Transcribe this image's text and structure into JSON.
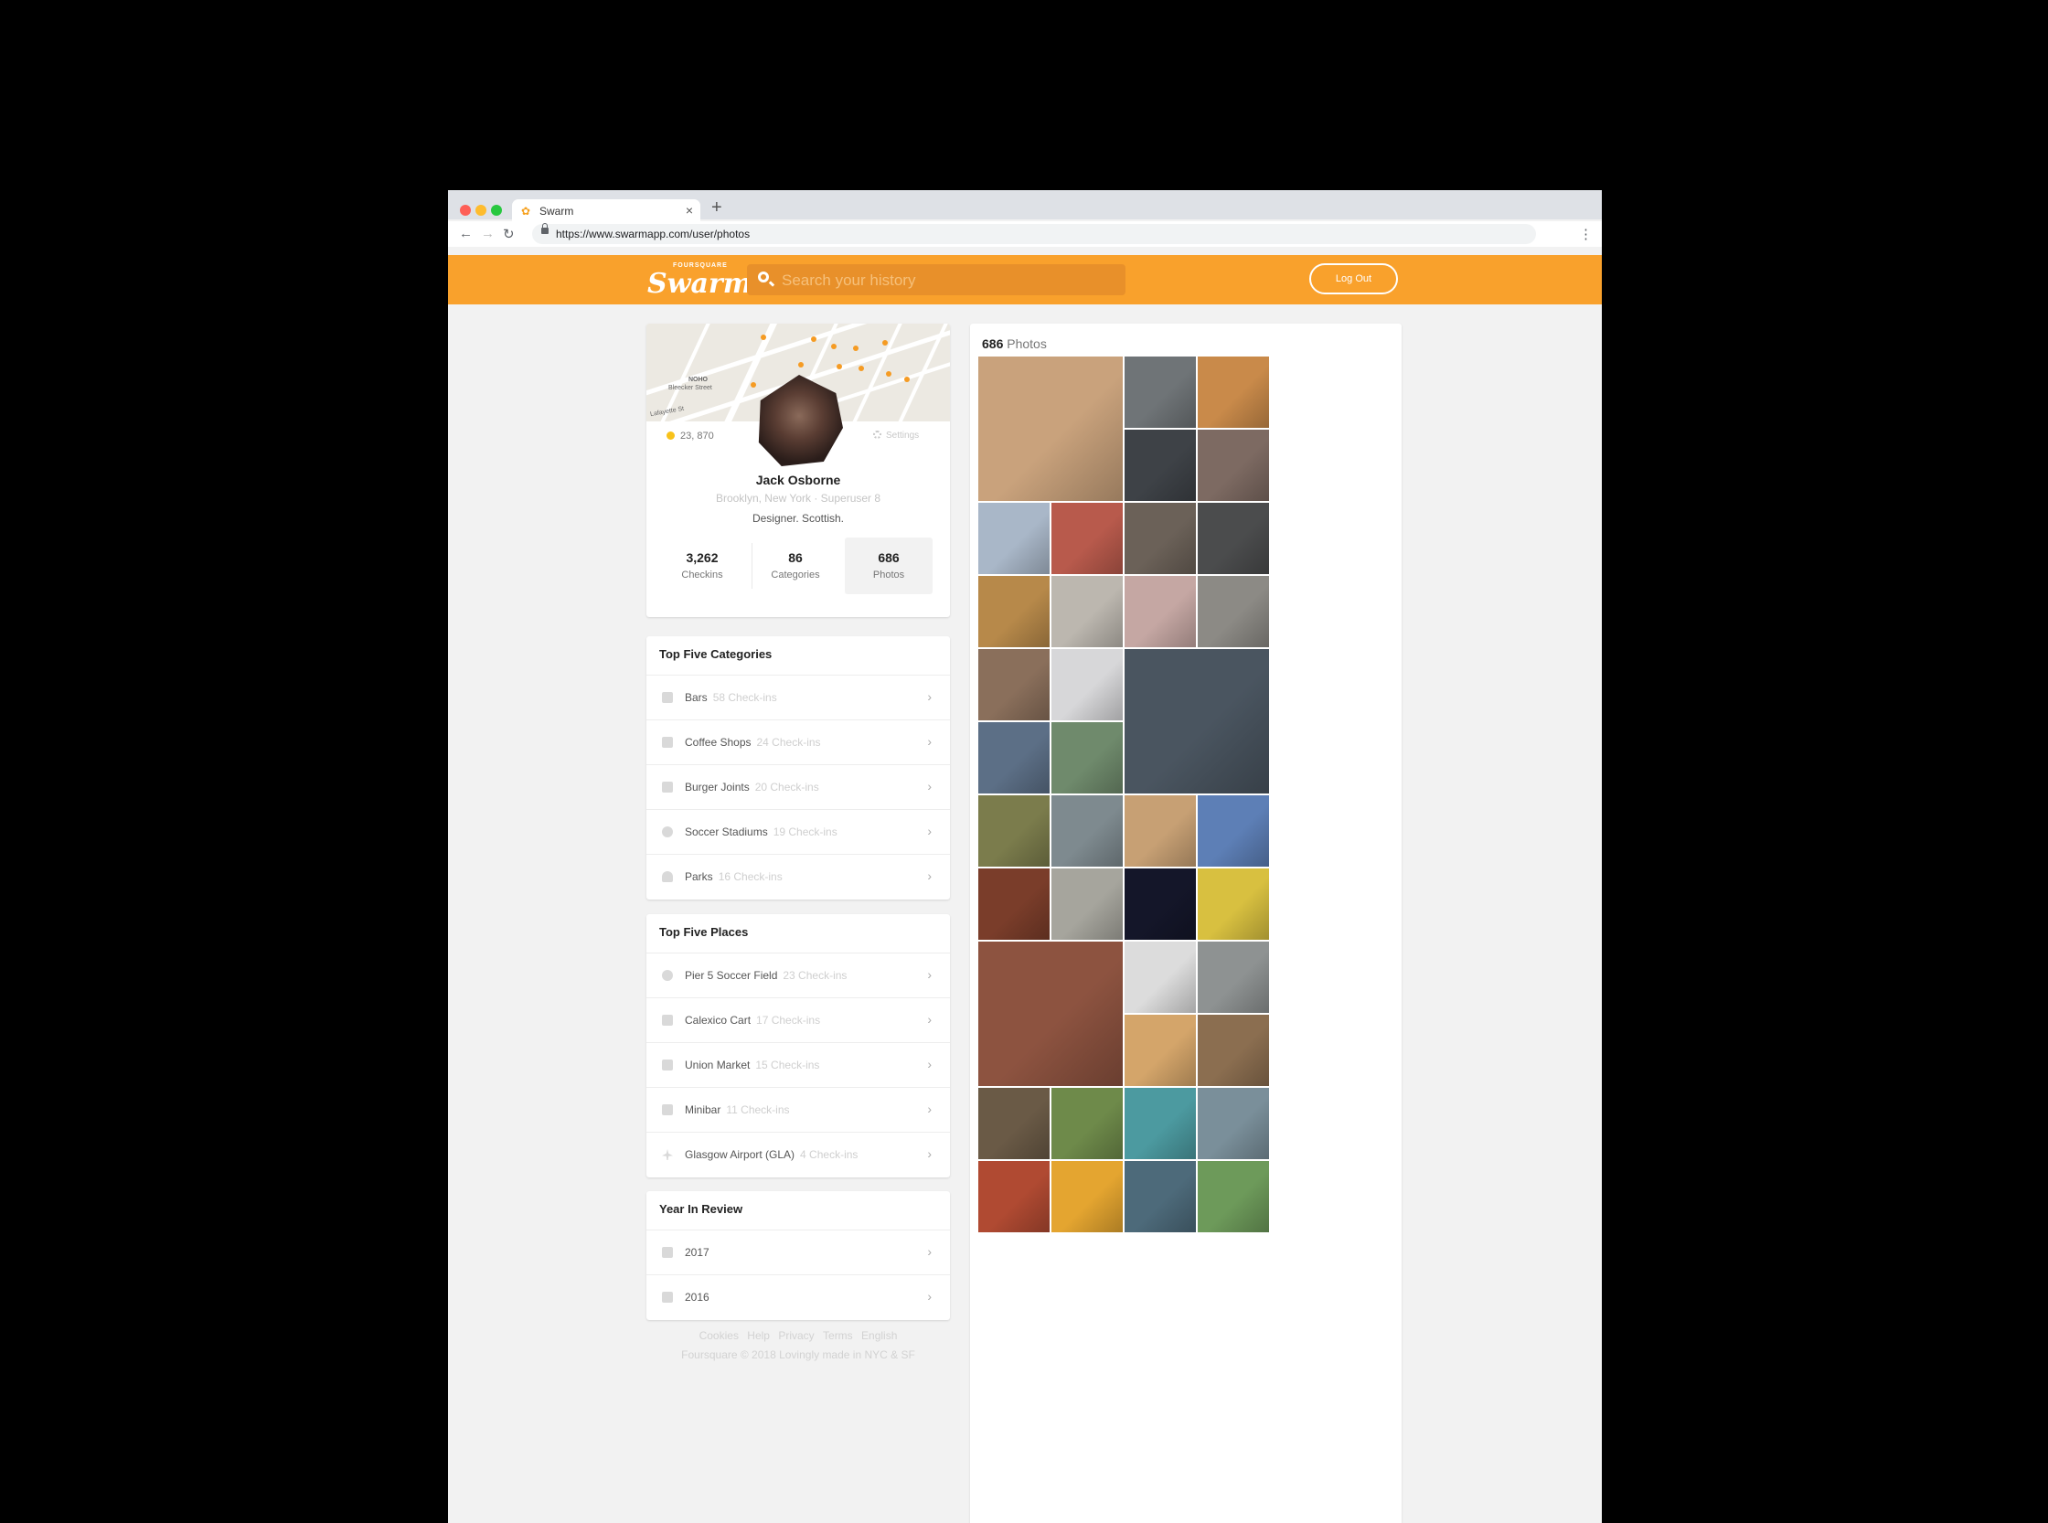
{
  "browser": {
    "tab_title": "Swarm",
    "tab_close": "×",
    "new_tab": "+",
    "url": "https://www.swarmapp.com/user/photos",
    "back": "←",
    "forward": "→",
    "reload": "↻",
    "menu": "⋮"
  },
  "header": {
    "logo_small": "FOURSQUARE",
    "logo_big": "Swarm",
    "search_placeholder": "Search your history",
    "logout_label": "Log Out",
    "brand_color": "#f9a12c"
  },
  "map": {
    "labels": [
      "NOHO",
      "Bleecker Street",
      "Lafayette St"
    ]
  },
  "profile": {
    "coins": "23, 870",
    "settings_label": "Settings",
    "name": "Jack Osborne",
    "location": "Brooklyn, New York · Superuser 8",
    "bio": "Designer. Scottish.",
    "stats": [
      {
        "value": "3,262",
        "label": "Checkins"
      },
      {
        "value": "86",
        "label": "Categories"
      },
      {
        "value": "686",
        "label": "Photos"
      }
    ]
  },
  "top_categories": {
    "title": "Top Five Categories",
    "items": [
      {
        "icon": "bar-icon",
        "name": "Bars",
        "count": "58 Check-ins"
      },
      {
        "icon": "coffee-icon",
        "name": "Coffee Shops",
        "count": "24 Check-ins"
      },
      {
        "icon": "burger-icon",
        "name": "Burger Joints",
        "count": "20 Check-ins"
      },
      {
        "icon": "soccer-ball-icon",
        "name": "Soccer Stadiums",
        "count": "19 Check-ins"
      },
      {
        "icon": "tree-icon",
        "name": "Parks",
        "count": "16 Check-ins"
      }
    ]
  },
  "top_places": {
    "title": "Top Five Places",
    "items": [
      {
        "icon": "soccer-ball-icon",
        "name": "Pier 5 Soccer Field",
        "count": "23 Check-ins"
      },
      {
        "icon": "food-truck-icon",
        "name": "Calexico Cart",
        "count": "17 Check-ins"
      },
      {
        "icon": "cart-icon",
        "name": "Union Market",
        "count": "15 Check-ins"
      },
      {
        "icon": "bar-icon",
        "name": "Minibar",
        "count": "11 Check-ins"
      },
      {
        "icon": "airplane-icon",
        "name": "Glasgow Airport (GLA)",
        "count": "4 Check-ins"
      }
    ]
  },
  "year_in_review": {
    "title": "Year In Review",
    "items": [
      {
        "icon": "calendar-icon",
        "name": "2017"
      },
      {
        "icon": "calendar-icon",
        "name": "2016"
      }
    ]
  },
  "footer": {
    "links": [
      "Cookies",
      "Help",
      "Privacy",
      "Terms",
      "English"
    ],
    "copyright": "Foursquare © 2018 Lovingly made in NYC & SF"
  },
  "photos": {
    "count": "686",
    "label": "Photos",
    "tiles": [
      {
        "color": "#c9a27c"
      },
      {
        "color": "#6f7477"
      },
      {
        "color": "#c98a4a"
      },
      {
        "color": "#3e4247"
      },
      {
        "color": "#7d6a62"
      },
      {
        "color": "#a9b7c8"
      },
      {
        "color": "#b85a4c"
      },
      {
        "color": "#6b6158"
      },
      {
        "color": "#4b4c4d"
      },
      {
        "color": "#b7894a"
      },
      {
        "color": "#bcb7af"
      },
      {
        "color": "#c5a7a3"
      },
      {
        "color": "#8c8a85"
      },
      {
        "color": "#8a6f5b"
      },
      {
        "color": "#d7d7d9"
      },
      {
        "color": "#4a5560"
      },
      {
        "color": "#5c6f86"
      },
      {
        "color": "#6f8a6c"
      },
      {
        "color": "#7b7c4c"
      },
      {
        "color": "#7e8a8f"
      },
      {
        "color": "#c7a074"
      },
      {
        "color": "#5d7fb6"
      },
      {
        "color": "#7a3d2a"
      },
      {
        "color": "#a6a59d"
      },
      {
        "color": "#141629"
      },
      {
        "color": "#d8c040"
      },
      {
        "color": "#8d5340"
      },
      {
        "color": "#dcdcdc"
      },
      {
        "color": "#8e9292"
      },
      {
        "color": "#d4a56a"
      },
      {
        "color": "#8b6e50"
      },
      {
        "color": "#6a5a46"
      },
      {
        "color": "#6e8a4a"
      },
      {
        "color": "#4c9aa0"
      },
      {
        "color": "#7a8f9a"
      },
      {
        "color": "#b04a32"
      },
      {
        "color": "#e4a530"
      },
      {
        "color": "#4d6a7a"
      },
      {
        "color": "#6d9a5a"
      }
    ]
  }
}
